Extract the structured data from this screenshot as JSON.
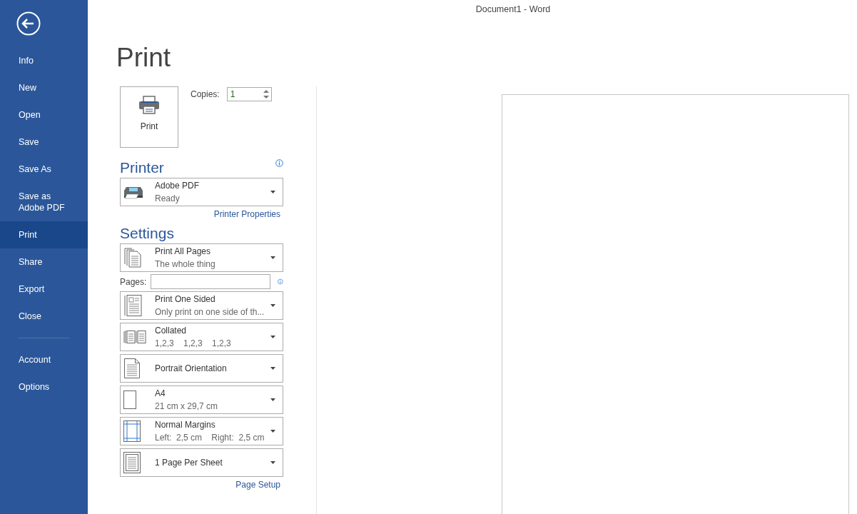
{
  "window": {
    "title": "Document1 - Word"
  },
  "sidebar": {
    "items": [
      {
        "label": "Info",
        "selected": false
      },
      {
        "label": "New",
        "selected": false
      },
      {
        "label": "Open",
        "selected": false
      },
      {
        "label": "Save",
        "selected": false
      },
      {
        "label": "Save As",
        "selected": false
      },
      {
        "label": "Save as Adobe PDF",
        "selected": false
      },
      {
        "label": "Print",
        "selected": true
      },
      {
        "label": "Share",
        "selected": false
      },
      {
        "label": "Export",
        "selected": false
      },
      {
        "label": "Close",
        "selected": false
      }
    ],
    "footer_items": [
      {
        "label": "Account",
        "selected": false
      },
      {
        "label": "Options",
        "selected": false
      }
    ]
  },
  "page_title": "Print",
  "print_button": {
    "label": "Print"
  },
  "copies": {
    "label": "Copies:",
    "value": "1"
  },
  "printer": {
    "heading": "Printer",
    "name": "Adobe PDF",
    "status": "Ready",
    "properties_link": "Printer Properties"
  },
  "settings": {
    "heading": "Settings",
    "rows": [
      {
        "kind": "pages",
        "title": "Print All Pages",
        "subtitle": "The whole thing"
      },
      {
        "kind": "pages-field",
        "label": "Pages:"
      },
      {
        "kind": "sides",
        "title": "Print One Sided",
        "subtitle": "Only print on one side of th..."
      },
      {
        "kind": "collate",
        "title": "Collated",
        "subtitle": "1,2,3    1,2,3    1,2,3"
      },
      {
        "kind": "orientation",
        "title": "Portrait Orientation"
      },
      {
        "kind": "size",
        "title": "A4",
        "subtitle": "21 cm x 29,7 cm"
      },
      {
        "kind": "margins",
        "title": "Normal Margins",
        "subtitle": "Left:  2,5 cm    Right:  2,5 cm"
      },
      {
        "kind": "sheets",
        "title": "1 Page Per Sheet"
      }
    ],
    "page_setup_link": "Page Setup"
  }
}
